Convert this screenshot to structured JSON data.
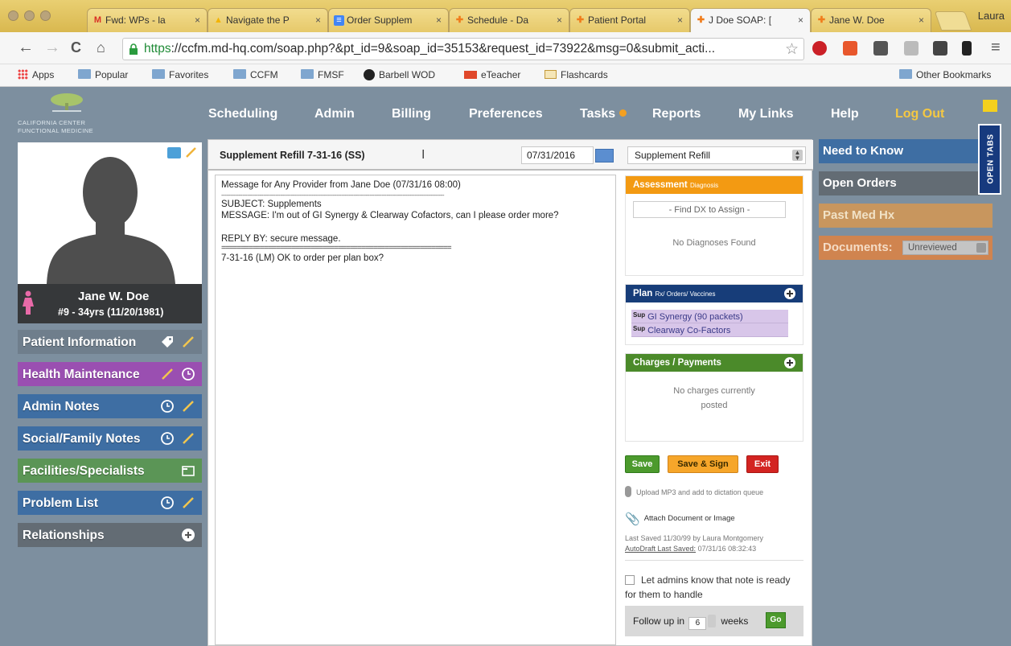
{
  "browser": {
    "tabs": [
      {
        "label": "Fwd: WPs - la",
        "favicon": "gmail-icon",
        "color": "#d93025"
      },
      {
        "label": "Navigate the P",
        "favicon": "drive-icon",
        "color": "#f4b400"
      },
      {
        "label": "Order Supplem",
        "favicon": "docs-icon",
        "color": "#4285f4"
      },
      {
        "label": "Schedule - Da",
        "favicon": "md-hq-icon",
        "color": "#f07c1b"
      },
      {
        "label": "Patient Portal",
        "favicon": "md-hq-icon",
        "color": "#f07c1b"
      },
      {
        "label": "J Doe SOAP: [",
        "favicon": "md-hq-icon",
        "color": "#f07c1b"
      },
      {
        "label": "Jane W. Doe",
        "favicon": "md-hq-icon",
        "color": "#f07c1b"
      }
    ],
    "profile": "Laura",
    "url_scheme": "https",
    "url_rest": "://ccfm.md-hq.com/soap.php?&pt_id=9&soap_id=35153&request_id=73922&msg=0&submit_acti...",
    "bookmarks": [
      "Apps",
      "Popular",
      "Favorites",
      "CCFM",
      "FMSF",
      "Barbell WOD",
      "eTeacher",
      "Flashcards"
    ],
    "other_bookmarks": "Other Bookmarks"
  },
  "app": {
    "logo_line1": "CALIFORNIA CENTER",
    "logo_line2": "FUNCTIONAL MEDICINE",
    "nav": [
      "Scheduling",
      "Admin",
      "Billing",
      "Preferences",
      "Tasks",
      "Reports",
      "My Links",
      "Help",
      "Log Out"
    ]
  },
  "patient": {
    "name": "Jane W. Doe",
    "info": "#9 - 34yrs (11/20/1981)"
  },
  "sidebar": [
    {
      "label": "Patient Information",
      "color": "#6f7e8c"
    },
    {
      "label": "Health Maintenance",
      "color": "#9a4fb1"
    },
    {
      "label": "Admin Notes",
      "color": "#3e6ea3"
    },
    {
      "label": "Social/Family Notes",
      "color": "#3e6ea3"
    },
    {
      "label": "Facilities/Specialists",
      "color": "#5b9556"
    },
    {
      "label": "Problem List",
      "color": "#3e6ea3"
    },
    {
      "label": "Relationships",
      "color": "#636c74"
    }
  ],
  "note": {
    "title": "Supplement Refill 7-31-16  (SS)",
    "date": "07/31/2016",
    "type": "Supplement Refill",
    "line1": "Message for Any Provider from Jane Doe (07/31/16 08:00)",
    "sep1": "--------------------------------------------------------------------------------------------------------------------------------",
    "line2": "SUBJECT: Supplements",
    "line3": "MESSAGE: I'm out of GI Synergy & Clearway Cofactors, can I please order more?",
    "line4": "REPLY BY: secure message.",
    "sep2": "===========================================================",
    "line5": "7-31-16 (LM) OK to order per plan box?"
  },
  "panels": {
    "assessment": {
      "title": "Assessment",
      "sub": "Diagnosis",
      "find": "- Find DX to Assign -",
      "empty": "No Diagnoses Found",
      "color": "#f39a12"
    },
    "plan": {
      "title": "Plan",
      "sub": "Rx/ Orders/ Vaccines",
      "color": "#173d79",
      "items": [
        {
          "tag": "Sup",
          "text": "GI Synergy (90 packets)"
        },
        {
          "tag": "Sup",
          "text": "Clearway Co-Factors"
        }
      ]
    },
    "charges": {
      "title": "Charges / Payments",
      "empty1": "No charges currently",
      "empty2": "posted",
      "color": "#4b8a2a"
    }
  },
  "actions": {
    "save": "Save",
    "save_sign": "Save & Sign",
    "exit": "Exit",
    "upload": "Upload MP3 and add to dictation queue",
    "attach": "Attach Document or Image",
    "last_saved": "Last Saved 11/30/99 by Laura Montgomery",
    "autodraft_label": "AutoDraft Last Saved:",
    "autodraft_time": "07/31/16 08:32:43",
    "admin_notify": "Let admins know that note is ready for them to handle",
    "followup_label": "Follow up in",
    "followup_value": "6",
    "followup_unit": "weeks",
    "go": "Go"
  },
  "right_sidebar": {
    "need_to_know": "Need to Know",
    "open_orders": "Open Orders",
    "past_med_hx": "Past Med Hx",
    "documents": "Documents:",
    "documents_filter": "Unreviewed",
    "open_tabs": "OPEN TABS"
  }
}
